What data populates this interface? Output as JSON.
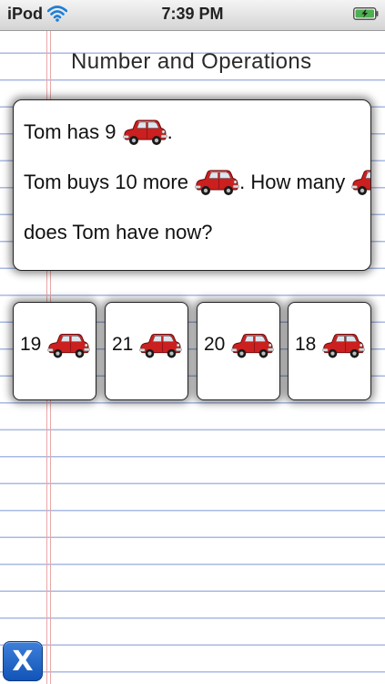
{
  "status_bar": {
    "carrier": "iPod",
    "time": "7:39 PM",
    "wifi_icon": "wifi-icon",
    "battery_icon": "battery-charging-icon",
    "battery_color": "#4caf50"
  },
  "page": {
    "title": "Number and Operations"
  },
  "question": {
    "line1_text": "Tom has 9",
    "line1_suffix": ".",
    "line2_text": "Tom buys 10 more",
    "line2_suffix": ". How many",
    "line3_text": "does Tom have now?",
    "object_icon": "red-car-icon"
  },
  "answers": [
    {
      "value": "19",
      "icon": "red-car-icon"
    },
    {
      "value": "21",
      "icon": "red-car-icon"
    },
    {
      "value": "20",
      "icon": "red-car-icon"
    },
    {
      "value": "18",
      "icon": "red-car-icon"
    }
  ],
  "close_button": {
    "label": "X",
    "color": "#1a5ec4"
  },
  "colors": {
    "ruled_line": "#a9b9e3",
    "margin_line": "#e8a7a7",
    "car_body": "#cc1f1f"
  }
}
